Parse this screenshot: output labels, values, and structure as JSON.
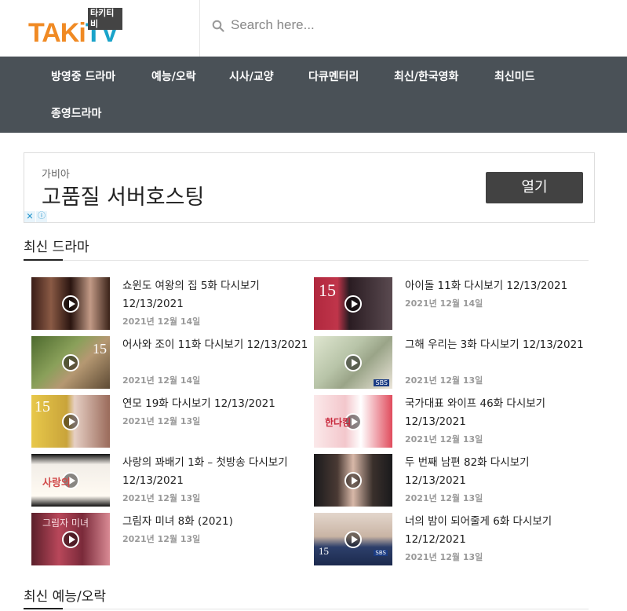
{
  "logo": {
    "main_a": "TAKi",
    "main_b": "TV",
    "sub": "타키티비"
  },
  "search": {
    "placeholder": "Search here..."
  },
  "nav": [
    "방영중 드라마",
    "예능/오락",
    "시사/교양",
    "다큐멘터리",
    "최신/한국영화",
    "최신미드",
    "종영드라마"
  ],
  "ad": {
    "advertiser": "가비아",
    "headline": "고품질 서버호스팅",
    "button": "열기",
    "close": "✕",
    "info": "ⓘ"
  },
  "sections": {
    "drama": "최신 드라마",
    "variety": "최신 예능/오락"
  },
  "posts_left": [
    {
      "title": "쇼윈도 여왕의 집 5화 다시보기 12/13/2021",
      "date": "2021년 12월 14일"
    },
    {
      "title": "어사와 조이 11화 다시보기 12/13/2021",
      "date": "2021년 12월 14일"
    },
    {
      "title": "연모 19화 다시보기 12/13/2021",
      "date": "2021년 12월 13일"
    },
    {
      "title": "사랑의 꽈배기 1화 – 첫방송 다시보기 12/13/2021",
      "date": "2021년 12월 13일"
    },
    {
      "title": "그림자 미녀 8화 (2021)",
      "date": "2021년 12월 13일"
    }
  ],
  "posts_right": [
    {
      "title": "아이돌 11화 다시보기 12/13/2021",
      "date": "2021년 12월 14일"
    },
    {
      "title": "그해 우리는 3화 다시보기 12/13/2021",
      "date": "2021년 12월 13일"
    },
    {
      "title": "국가대표 와이프 46화 다시보기 12/13/2021",
      "date": "2021년 12월 13일"
    },
    {
      "title": "두 번째 남편 82화 다시보기 12/13/2021",
      "date": "2021년 12월 13일"
    },
    {
      "title": "너의 밤이 되어줄게 6화 다시보기 12/12/2021",
      "date": "2021년 12월 13일"
    }
  ],
  "thumb_overlays": {
    "t15": "15",
    "sbs": "SBS",
    "l1": "사랑의",
    "l2": "그림자 미녀",
    "l3": "한다킴"
  }
}
